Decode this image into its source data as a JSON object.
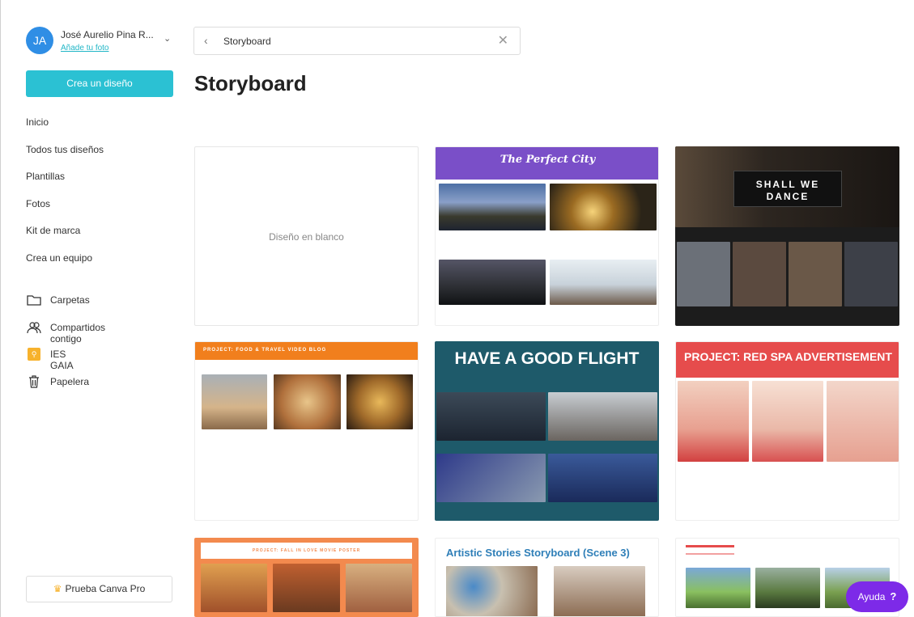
{
  "user": {
    "initials": "JA",
    "name": "José Aurelio Pina R...",
    "add_photo": "Añade tu foto"
  },
  "sidebar": {
    "create_label": "Crea un diseño",
    "nav": [
      "Inicio",
      "Todos tus diseños",
      "Plantillas",
      "Fotos",
      "Kit de marca",
      "Crea un equipo"
    ],
    "tools": [
      {
        "label": "Carpetas",
        "icon": "folder-icon"
      },
      {
        "label": "Compartidos contigo",
        "icon": "people-icon"
      },
      {
        "label": "IES GAIA",
        "icon": "team-badge-icon"
      },
      {
        "label": "Papelera",
        "icon": "trash-icon"
      }
    ],
    "pro_label": "Prueba Canva Pro"
  },
  "search": {
    "value": "Storyboard"
  },
  "page_title": "Storyboard",
  "cards": {
    "blank": "Diseño en blanco",
    "perfect_city": "The Perfect City",
    "shall_we_dance": "SHALL WE DANCE",
    "food_travel": "PROJECT: FOOD & TRAVEL VIDEO BLOG",
    "good_flight": "HAVE A GOOD FLIGHT",
    "red_spa": "PROJECT: RED SPA ADVERTISEMENT",
    "fall_in_love": "PROJECT: FALL IN LOVE MOVIE POSTER",
    "artistic": "Artistic Stories Storyboard (Scene 3)"
  },
  "help": {
    "label": "Ayuda",
    "mark": "?"
  },
  "colors": {
    "accent": "#2bc1d3",
    "help": "#7d2ae8",
    "purple_header": "#7a4fc8",
    "orange_header": "#f17f1d",
    "teal": "#1e5a6a",
    "red_header": "#e64c4c"
  }
}
